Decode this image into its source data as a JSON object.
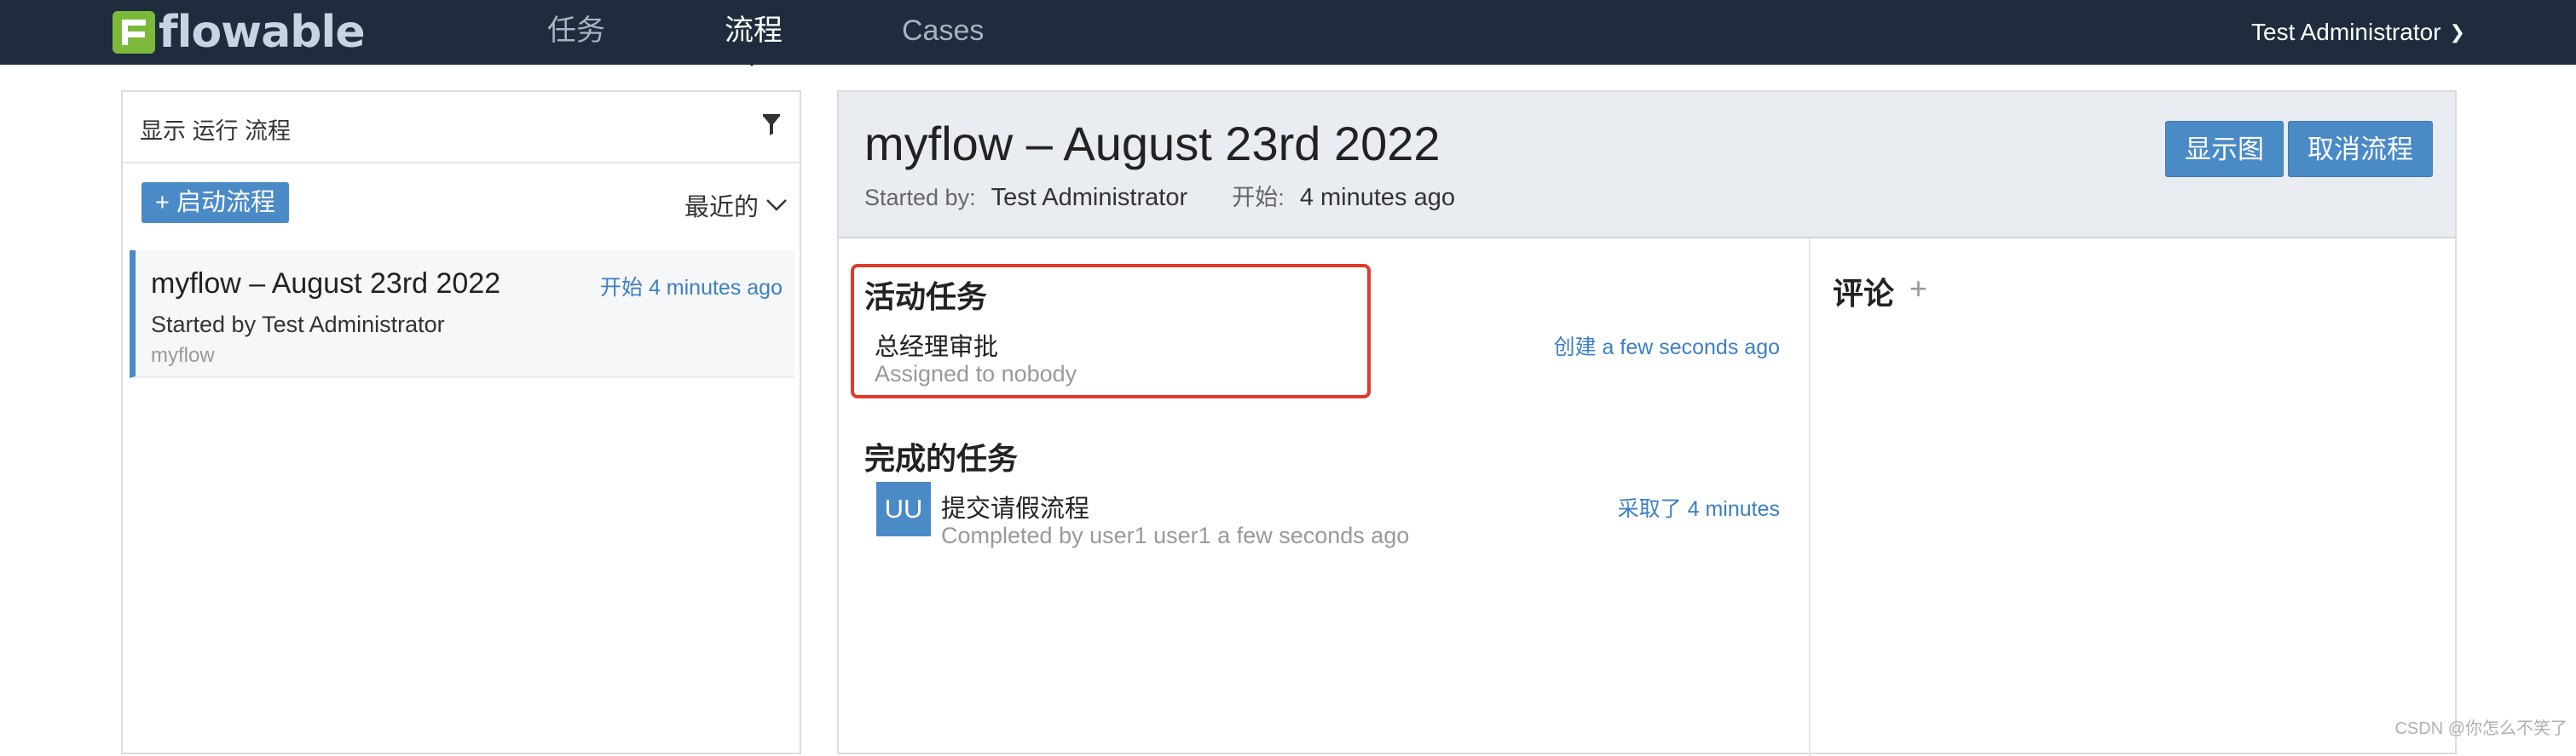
{
  "navbar": {
    "logo_text": "flowable",
    "tabs": [
      {
        "label": "任务"
      },
      {
        "label": "流程"
      },
      {
        "label": "Cases"
      }
    ],
    "user": "Test Administrator"
  },
  "left": {
    "filter_label": "显示 运行 流程",
    "start_button": "+ 启动流程",
    "sort_label": "最近的",
    "items": [
      {
        "title": "myflow – August 23rd 2022",
        "when": "开始 4 minutes ago",
        "started_by": "Started by Test Administrator",
        "definition": "myflow"
      }
    ]
  },
  "detail": {
    "title": "myflow – August 23rd 2022",
    "started_by_label": "Started by:",
    "started_by": "Test Administrator",
    "start_label": "开始:",
    "start_time": "4 minutes ago",
    "show_diagram_button": "显示图",
    "cancel_button": "取消流程",
    "active_tasks_title": "活动任务",
    "active_tasks": [
      {
        "name": "总经理审批",
        "assignee": "Assigned to nobody",
        "when": "创建 a few seconds ago"
      }
    ],
    "completed_tasks_title": "完成的任务",
    "completed_tasks": [
      {
        "avatar": "UU",
        "name": "提交请假流程",
        "completed_by": "Completed by user1 user1 a few seconds ago",
        "when": "采取了 4 minutes"
      }
    ],
    "comments_title": "评论",
    "add_comment": "+"
  },
  "watermark": "CSDN @你怎么不笑了",
  "colors": {
    "navbar": "#1f2c3d",
    "accent": "#4a8ac7",
    "logo_green": "#7cb93b",
    "highlight": "#e03a2b"
  }
}
